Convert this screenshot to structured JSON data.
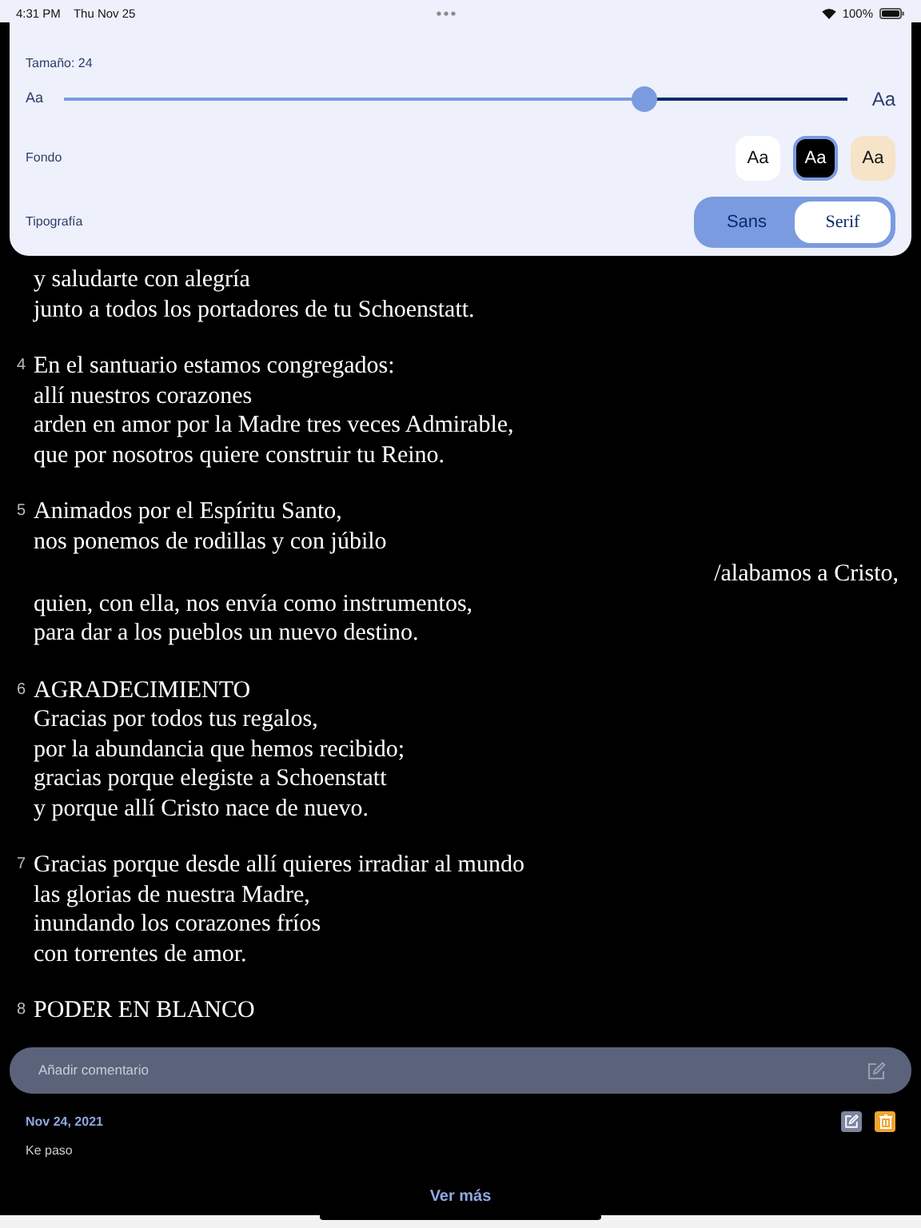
{
  "status_bar": {
    "time": "4:31 PM",
    "date": "Thu Nov 25",
    "battery": "100%"
  },
  "settings": {
    "size_label": "Tamaño: 24",
    "size_slider": {
      "level": 0.74
    },
    "small_sample": "Aa",
    "large_sample": "Aa",
    "background_label": "Fondo",
    "background_options": [
      {
        "label": "Aa",
        "color": "#ffffff",
        "selected": false
      },
      {
        "label": "Aa",
        "color": "#000000",
        "selected": true
      },
      {
        "label": "Aa",
        "color": "#f7e3c8",
        "selected": false
      }
    ],
    "font_label": "Tipografía",
    "font_options": [
      {
        "label": "Sans",
        "kind": "sans",
        "selected": false
      },
      {
        "label": "Serif",
        "kind": "serif",
        "selected": true
      }
    ]
  },
  "poem": [
    {
      "lines": [
        {
          "text": "y saludarte con alegría",
          "kind": "line"
        },
        {
          "text": "junto a todos los portadores de tu Schoenstatt.",
          "kind": "line"
        }
      ]
    },
    {
      "number": "4",
      "lines": [
        {
          "text": "En el santuario estamos congregados:",
          "kind": "line"
        },
        {
          "text": "allí nuestros corazones",
          "kind": "line"
        },
        {
          "text": "arden en amor por la Madre tres veces Admirable,",
          "kind": "line"
        },
        {
          "text": "que por nosotros quiere construir tu Reino.",
          "kind": "line"
        }
      ]
    },
    {
      "number": "5",
      "lines": [
        {
          "text": "Animados por el Espíritu Santo,",
          "kind": "line"
        },
        {
          "text": "nos ponemos de rodillas y con júbilo",
          "kind": "line"
        },
        {
          "text": "/alabamos a Cristo,",
          "kind": "right"
        },
        {
          "text": "quien, con ella, nos envía como instrumentos,",
          "kind": "line"
        },
        {
          "text": "para dar a los pueblos un nuevo destino.",
          "kind": "line"
        }
      ]
    },
    {
      "number": "6",
      "lines": [
        {
          "text": "AGRADECIMIENTO",
          "kind": "line"
        },
        {
          "text": "Gracias por todos tus regalos,",
          "kind": "line"
        },
        {
          "text": "por la abundancia que hemos recibido;",
          "kind": "line"
        },
        {
          "text": "gracias porque elegiste a Schoenstatt",
          "kind": "line"
        },
        {
          "text": "y porque allí Cristo nace de nuevo.",
          "kind": "line"
        }
      ]
    },
    {
      "number": "7",
      "lines": [
        {
          "text": "Gracias porque desde allí quieres irradiar al mundo",
          "kind": "line"
        },
        {
          "text": "las glorias de nuestra Madre,",
          "kind": "line"
        },
        {
          "text": "inundando los corazones fríos",
          "kind": "line"
        },
        {
          "text": "con torrentes de amor.",
          "kind": "line"
        }
      ]
    },
    {
      "number": "8",
      "lines": [
        {
          "text": "PODER EN BLANCO",
          "kind": "line"
        }
      ]
    }
  ],
  "comment_field": {
    "placeholder": "Añadir comentario"
  },
  "comments": [
    {
      "date": "Nov 24, 2021",
      "text": "Ke paso"
    }
  ],
  "more_link": "Ver más"
}
